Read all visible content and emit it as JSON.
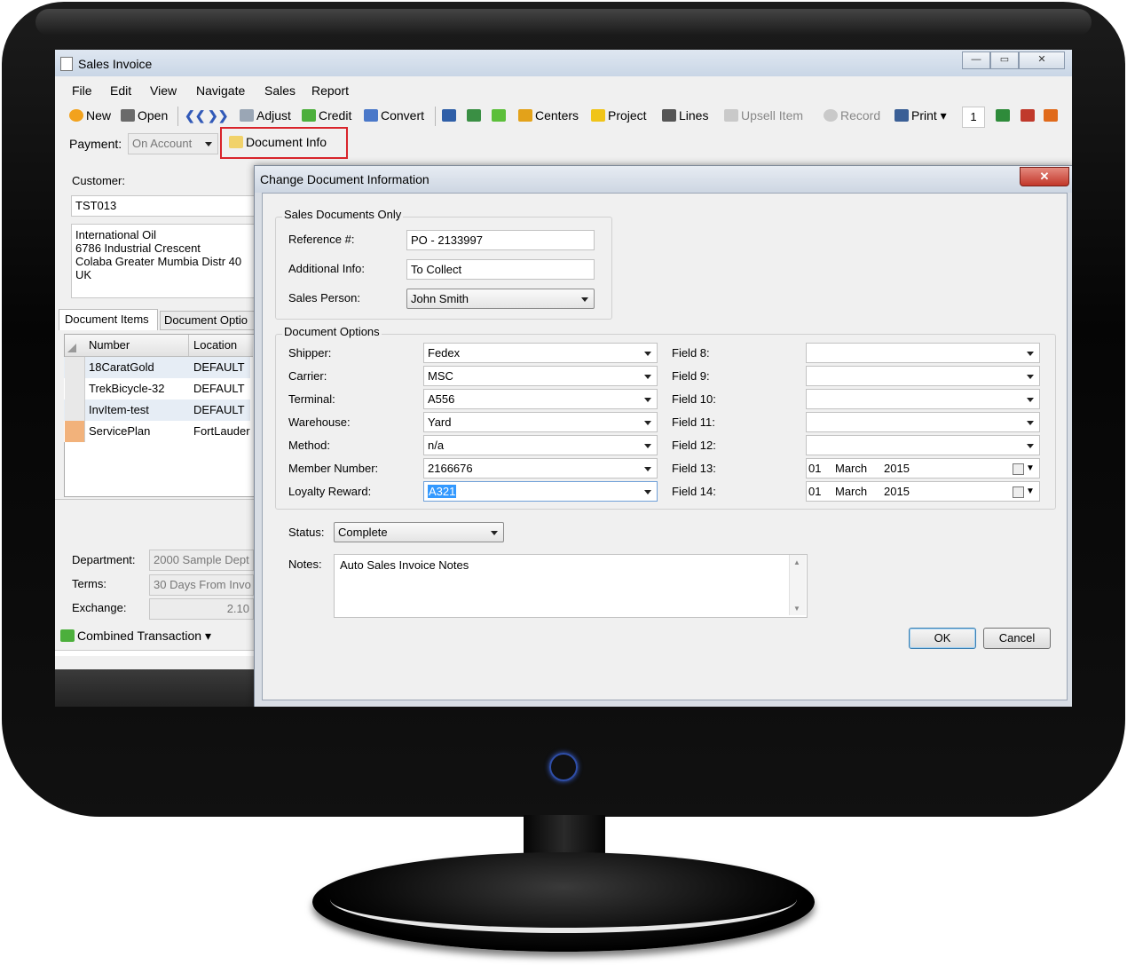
{
  "window": {
    "title": "Sales Invoice",
    "controls": [
      "—",
      "▭",
      "✕"
    ]
  },
  "menu": [
    "File",
    "Edit",
    "View",
    "Navigate",
    "Sales",
    "Report"
  ],
  "toolbar": {
    "new": "New",
    "open": "Open",
    "adjust": "Adjust",
    "credit": "Credit",
    "convert": "Convert",
    "centers": "Centers",
    "project": "Project",
    "lines": "Lines",
    "upsell": "Upsell Item",
    "record": "Record",
    "print": "Print",
    "copies": "1"
  },
  "payment": {
    "label": "Payment:",
    "value": "On Account"
  },
  "document_info_button": "Document Info",
  "customer": {
    "label": "Customer:",
    "code": "TST013",
    "address": [
      "International Oil",
      "6786 Industrial Crescent",
      "Colaba  Greater Mumbia Distr  40",
      "UK"
    ]
  },
  "tabs": [
    "Document Items",
    "Document Optio"
  ],
  "grid": {
    "headers": [
      "Number",
      "Location"
    ],
    "rows": [
      {
        "number": "18CaratGold",
        "location": "DEFAULT"
      },
      {
        "number": "TrekBicycle-32",
        "location": "DEFAULT"
      },
      {
        "number": "InvItem-test",
        "location": "DEFAULT"
      },
      {
        "number": "ServicePlan",
        "location": "FortLauder"
      }
    ]
  },
  "footer": {
    "department_label": "Department:",
    "department": "2000 Sample Dept",
    "terms_label": "Terms:",
    "terms": "30 Days From Invo",
    "exchange_label": "Exchange:",
    "exchange": "2.10",
    "combined": "Combined Transaction"
  },
  "dialog": {
    "title": "Change Document Information",
    "close": "✕",
    "sales_docs": {
      "title": "Sales Documents Only",
      "reference_label": "Reference #:",
      "reference": "PO - 2133997",
      "additional_label": "Additional Info:",
      "additional": "To Collect",
      "salesperson_label": "Sales Person:",
      "salesperson": "John Smith"
    },
    "doc_options": {
      "title": "Document Options",
      "left": [
        {
          "label": "Shipper:",
          "value": "Fedex"
        },
        {
          "label": "Carrier:",
          "value": "MSC"
        },
        {
          "label": "Terminal:",
          "value": "A556"
        },
        {
          "label": "Warehouse:",
          "value": "Yard"
        },
        {
          "label": "Method:",
          "value": "n/a"
        },
        {
          "label": "Member Number:",
          "value": "2166676"
        },
        {
          "label": "Loyalty Reward:",
          "value": "A321"
        }
      ],
      "right": [
        {
          "label": "Field 8:",
          "value": ""
        },
        {
          "label": "Field 9:",
          "value": ""
        },
        {
          "label": "Field 10:",
          "value": ""
        },
        {
          "label": "Field 11:",
          "value": ""
        },
        {
          "label": "Field 12:",
          "value": ""
        }
      ],
      "field13": {
        "label": "Field 13:",
        "day": "01",
        "month": "March",
        "year": "2015"
      },
      "field14": {
        "label": "Field 14:",
        "day": "01",
        "month": "March",
        "year": "2015"
      }
    },
    "status_label": "Status:",
    "status": "Complete",
    "notes_label": "Notes:",
    "notes": "Auto Sales Invoice Notes",
    "ok": "OK",
    "cancel": "Cancel"
  },
  "colors": {
    "highlight": "#d9242b",
    "selection": "#3399ff",
    "power": "#3a63d8"
  }
}
